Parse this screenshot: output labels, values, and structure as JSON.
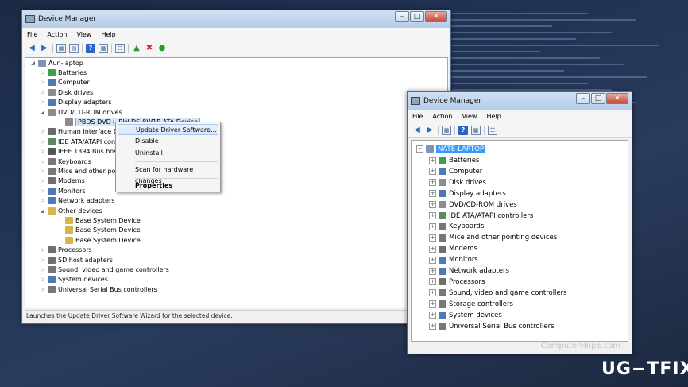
{
  "window1": {
    "title": "Device Manager",
    "menu": [
      "File",
      "Action",
      "View",
      "Help"
    ],
    "tree_root": "Aun-laptop",
    "nodes": [
      {
        "label": "Batteries",
        "expanded": false,
        "icon_color": "#3aa04a"
      },
      {
        "label": "Computer",
        "expanded": false,
        "icon_color": "#4f79b3"
      },
      {
        "label": "Disk drives",
        "expanded": false,
        "icon_color": "#8c8c8c"
      },
      {
        "label": "Display adapters",
        "expanded": false,
        "icon_color": "#4f79b3"
      },
      {
        "label": "DVD/CD-ROM drives",
        "expanded": true,
        "icon_color": "#8c8c8c"
      },
      {
        "label": "PBDS DVD+-RW DS-8W1P ATA Device",
        "child": true,
        "selected": true,
        "icon_color": "#8c8c8c"
      },
      {
        "label": "Human Interface Dev",
        "expanded": false,
        "icon_color": "#6a6a6a"
      },
      {
        "label": "IDE ATA/ATAPI contr",
        "expanded": false,
        "icon_color": "#5c8a5c"
      },
      {
        "label": "IEEE 1394 Bus host c",
        "expanded": false,
        "icon_color": "#555555"
      },
      {
        "label": "Keyboards",
        "expanded": false,
        "icon_color": "#777777"
      },
      {
        "label": "Mice and other poin",
        "expanded": false,
        "icon_color": "#777777"
      },
      {
        "label": "Modems",
        "expanded": false,
        "icon_color": "#6f6f6f"
      },
      {
        "label": "Monitors",
        "expanded": false,
        "icon_color": "#4f79b3"
      },
      {
        "label": "Network adapters",
        "expanded": false,
        "icon_color": "#4f79b3"
      },
      {
        "label": "Other devices",
        "expanded": true,
        "icon_color": "#d6b64a"
      },
      {
        "label": "Base System Device",
        "child": true,
        "icon_color": "#d6b64a"
      },
      {
        "label": "Base System Device",
        "child": true,
        "icon_color": "#d6b64a"
      },
      {
        "label": "Base System Device",
        "child": true,
        "icon_color": "#d6b64a"
      },
      {
        "label": "Processors",
        "expanded": false,
        "icon_color": "#6f6f6f"
      },
      {
        "label": "SD host adapters",
        "expanded": false,
        "icon_color": "#6f6f6f"
      },
      {
        "label": "Sound, video and game controllers",
        "expanded": false,
        "icon_color": "#777777"
      },
      {
        "label": "System devices",
        "expanded": false,
        "icon_color": "#4f79b3"
      },
      {
        "label": "Universal Serial Bus controllers",
        "expanded": false,
        "icon_color": "#777777"
      }
    ],
    "status": "Launches the Update Driver Software Wizard for the selected device."
  },
  "context_menu": {
    "items": [
      "Update Driver Software...",
      "Disable",
      "Uninstall",
      "Scan for hardware changes",
      "Properties"
    ]
  },
  "window2": {
    "title": "Device Manager",
    "menu": [
      "File",
      "Action",
      "View",
      "Help"
    ],
    "tree_root": "NATE-LAPTOP",
    "nodes": [
      {
        "label": "Batteries",
        "icon_color": "#3aa04a"
      },
      {
        "label": "Computer",
        "icon_color": "#4f79b3"
      },
      {
        "label": "Disk drives",
        "icon_color": "#8c8c8c"
      },
      {
        "label": "Display adapters",
        "icon_color": "#4f79b3"
      },
      {
        "label": "DVD/CD-ROM drives",
        "icon_color": "#8c8c8c"
      },
      {
        "label": "IDE ATA/ATAPI controllers",
        "icon_color": "#5c8a5c"
      },
      {
        "label": "Keyboards",
        "icon_color": "#777777"
      },
      {
        "label": "Mice and other pointing devices",
        "icon_color": "#777777"
      },
      {
        "label": "Modems",
        "icon_color": "#6f6f6f"
      },
      {
        "label": "Monitors",
        "icon_color": "#4f79b3"
      },
      {
        "label": "Network adapters",
        "icon_color": "#4f79b3"
      },
      {
        "label": "Processors",
        "icon_color": "#6f6f6f"
      },
      {
        "label": "Sound, video and game controllers",
        "icon_color": "#777777"
      },
      {
        "label": "Storage controllers",
        "icon_color": "#777777"
      },
      {
        "label": "System devices",
        "icon_color": "#4f79b3"
      },
      {
        "label": "Universal Serial Bus controllers",
        "icon_color": "#777777"
      }
    ],
    "watermark": "ComputerHope.com"
  },
  "brand": {
    "logo_text": "UG−TFIX"
  }
}
